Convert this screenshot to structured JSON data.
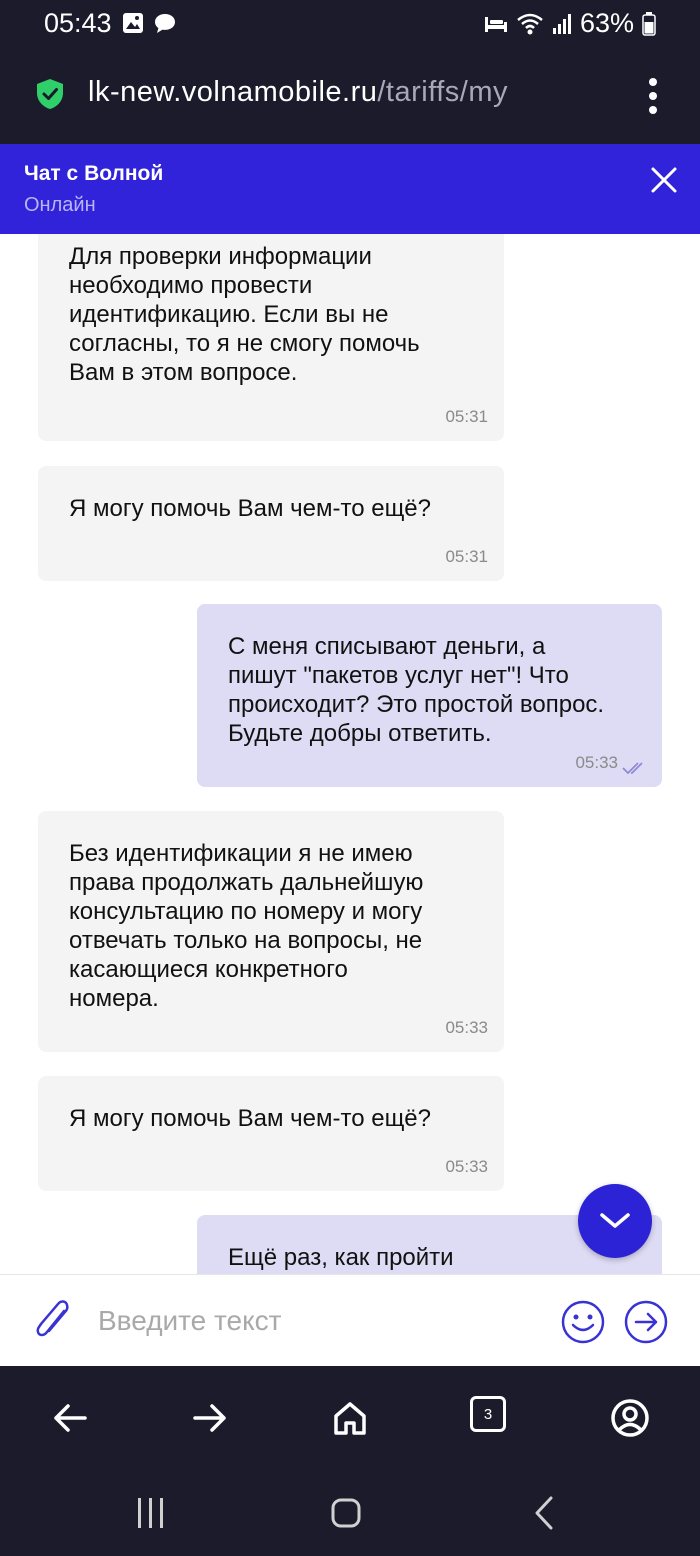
{
  "status_bar": {
    "time": "05:43",
    "battery": "63%",
    "icons": [
      "image-icon",
      "chat-bubble-icon",
      "bed-icon",
      "wifi-icon",
      "signal-icon",
      "battery-icon"
    ]
  },
  "browser": {
    "url_host": "lk-new.volnamobile.ru",
    "url_path": "/tariffs/my",
    "tab_count": "3"
  },
  "chat": {
    "title": "Чат с Волной",
    "status": "Онлайн",
    "messages": [
      {
        "direction": "in",
        "text": "Для проверки информации\nнеобходимо провести\nидентификацию. Если вы не\nсогласны, то я не смогу помочь\nВам в этом вопросе.",
        "time": "05:31"
      },
      {
        "direction": "in",
        "text": "Я могу помочь Вам чем-то ещё?",
        "time": "05:31"
      },
      {
        "direction": "out",
        "text": "С меня списывают деньги, а\nпишут \"пакетов услуг нет\"! Что\nпроисходит? Это простой вопрос.\nБудьте добры ответить.",
        "time": "05:33",
        "read": true
      },
      {
        "direction": "in",
        "text": "Без идентификации я не имею\nправа продолжать дальнейшую\nконсультацию по номеру и могу\nотвечать только на вопросы, не\nкасающиеся конкретного\nномера.",
        "time": "05:33"
      },
      {
        "direction": "in",
        "text": "Я могу помочь Вам чем-то ещё?",
        "time": "05:33"
      },
      {
        "direction": "out",
        "text": "Ещё раз, как пройти\nидентификацию?",
        "time": ""
      }
    ],
    "input_placeholder": "Введите текст"
  },
  "colors": {
    "header_bg": "#3023d9",
    "incoming_bubble": "#f4f4f4",
    "outgoing_bubble": "#dedcf5",
    "accent": "#2c23d6",
    "system_bar": "#1c1b2b"
  }
}
